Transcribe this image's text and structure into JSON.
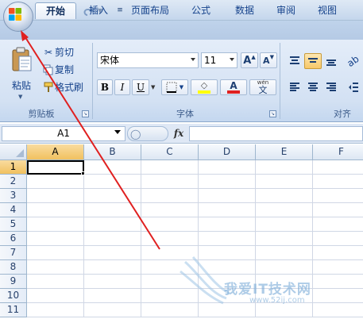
{
  "ribbon_tabs": [
    "开始",
    "插入",
    "页面布局",
    "公式",
    "数据",
    "审阅",
    "视图"
  ],
  "active_tab": "开始",
  "clipboard": {
    "paste_label": "粘贴",
    "cut_label": "剪切",
    "copy_label": "复制",
    "format_painter_label": "格式刷",
    "group_label": "剪贴板"
  },
  "font": {
    "font_name": "宋体",
    "font_size": "11",
    "grow_label": "A",
    "shrink_label": "A",
    "bold": "B",
    "italic": "I",
    "underline": "U",
    "font_color_letter": "A",
    "phonetic_top": "wén",
    "phonetic_char": "文",
    "group_label": "字体"
  },
  "alignment": {
    "group_label": "对齐"
  },
  "formula_bar": {
    "name_box": "A1",
    "fx": "fx"
  },
  "sheet": {
    "columns": [
      "A",
      "B",
      "C",
      "D",
      "E",
      "F"
    ],
    "rows": [
      "1",
      "2",
      "3",
      "4",
      "5",
      "6",
      "7",
      "8",
      "9",
      "10",
      "11"
    ],
    "active_cell": "A1"
  },
  "watermark": {
    "text": "我爱IT技术网",
    "url": "www.52ij.com"
  },
  "colors": {
    "font_color_bar": "#e02020",
    "highlight_bar": "#ffff00",
    "annotation_arrow": "#e02020",
    "active_header": "#f4c765"
  }
}
